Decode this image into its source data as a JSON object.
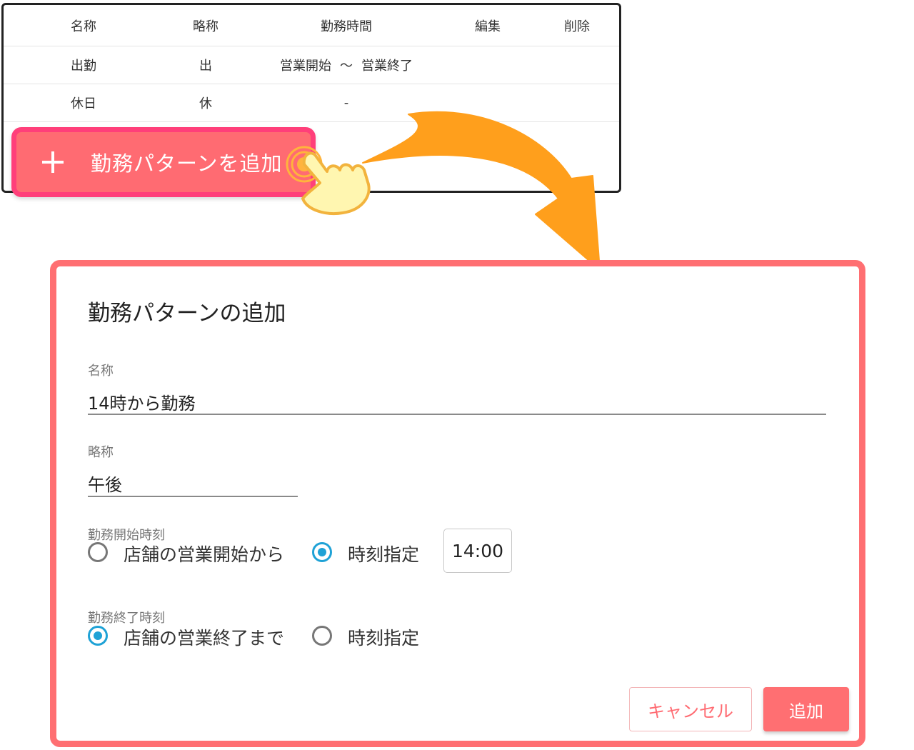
{
  "table": {
    "headers": {
      "name": "名称",
      "abbr": "略称",
      "time": "勤務時間",
      "edit": "編集",
      "delete": "削除"
    },
    "rows": [
      {
        "name": "出勤",
        "abbr": "出",
        "time_start": "営業開始",
        "time_sep": "～",
        "time_end": "営業終了"
      },
      {
        "name": "休日",
        "abbr": "休",
        "time": "-"
      }
    ]
  },
  "add_button": {
    "label": "勤務パターンを追加",
    "icon": "plus-icon"
  },
  "dialog": {
    "title": "勤務パターンの追加",
    "name_field": {
      "label": "名称",
      "value": "14時から勤務"
    },
    "abbr_field": {
      "label": "略称",
      "value": "午後"
    },
    "start": {
      "label": "勤務開始時刻",
      "option_store": "店舗の営業開始から",
      "option_specify": "時刻指定",
      "selected": "specify",
      "time_value": "14:00"
    },
    "end": {
      "label": "勤務終了時刻",
      "option_store": "店舗の営業終了まで",
      "option_specify": "時刻指定",
      "selected": "store"
    },
    "cancel_label": "キャンセル",
    "add_label": "追加"
  },
  "colors": {
    "accent": "#ff6f72",
    "button_border": "#ff3f7a",
    "radio_checked": "#1fa2d6",
    "arrow": "#ff9f1c"
  }
}
